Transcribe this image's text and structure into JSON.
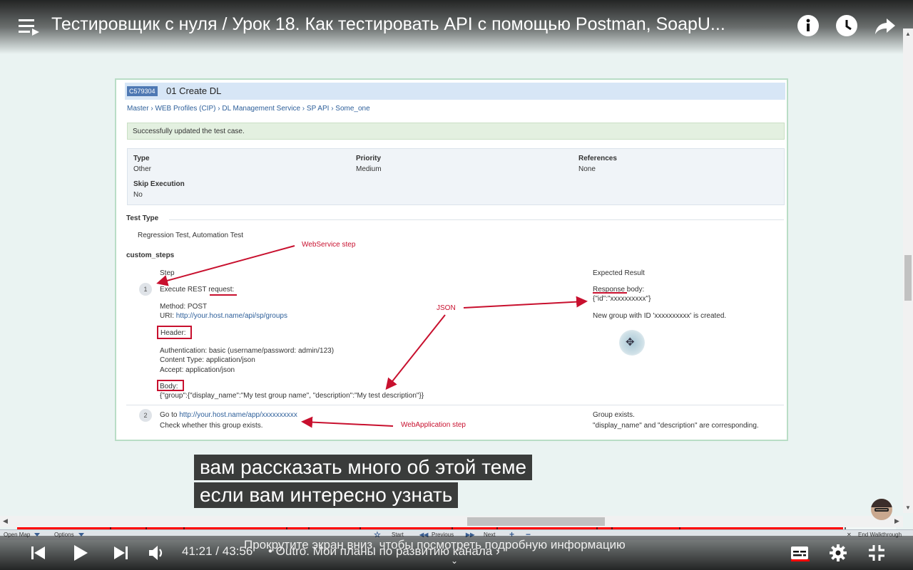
{
  "player": {
    "title": "Тестировщик с нуля / Урок 18. Как тестировать API с помощью Postman, SoapU...",
    "time_current": "41:21",
    "time_separator": "/",
    "time_total": "43:56",
    "chapter": "• Outro. Мои планы по развитию канала ›",
    "scroll_hint": "Прокрутите экран вниз, чтобы посмотреть подробную информацию",
    "progress_fraction": 0.94
  },
  "captions": [
    "вам рассказать много об этой теме",
    "если вам интересно узнать"
  ],
  "slide": {
    "case_id": "C579304",
    "case_title": "01 Create DL",
    "breadcrumb": "Master › WEB Profiles (CIP) › DL Management Service › SP API › Some_one",
    "success_message": "Successfully updated the test case.",
    "props": {
      "type_label": "Type",
      "type_value": "Other",
      "priority_label": "Priority",
      "priority_value": "Medium",
      "references_label": "References",
      "references_value": "None",
      "skip_label": "Skip Execution",
      "skip_value": "No"
    },
    "test_type_label": "Test Type",
    "test_type_value": "Regression Test, Automation Test",
    "custom_steps_label": "custom_steps",
    "col_step": "Step",
    "col_expected": "Expected Result",
    "step1": {
      "num": "1",
      "execute_prefix": "Execute REST ",
      "execute_word": "request",
      "execute_suffix": ":",
      "method": "Method: POST",
      "uri_label": "URI: ",
      "uri": "http://your.host.name/api/sp/groups",
      "header": "Header:",
      "auth": "Authentication: basic (username/password: admin/123)",
      "content_type": "Content Type: application/json",
      "accept": "Accept: application/json",
      "body": "Body:",
      "body_json": "{\"group\":{\"display_name\":\"My test group name\", \"description\":\"My test description\"}}",
      "expected_word": "Response",
      "expected_suffix": " body:",
      "expected_json": "{\"id\":\"xxxxxxxxxx\"}",
      "expected_msg": "New group with ID 'xxxxxxxxxx' is created."
    },
    "step2": {
      "num": "2",
      "goto_label": "Go to ",
      "goto_url": "http://your.host.name/app/xxxxxxxxxx",
      "check": "Check whether this group exists.",
      "expected1": "Group exists.",
      "expected2": "\"display_name\" and \"description\" are corresponding."
    },
    "annotations": {
      "webservice": "WebService step",
      "json": "JSON",
      "webapp": "WebApplication step"
    }
  },
  "walkthrough": {
    "open_map": "Open Map",
    "options": "Options",
    "start": "Start",
    "previous": "Previous",
    "next": "Next",
    "plus": "+",
    "minus": "−",
    "close": "✕",
    "end": "End Walkthrough"
  }
}
